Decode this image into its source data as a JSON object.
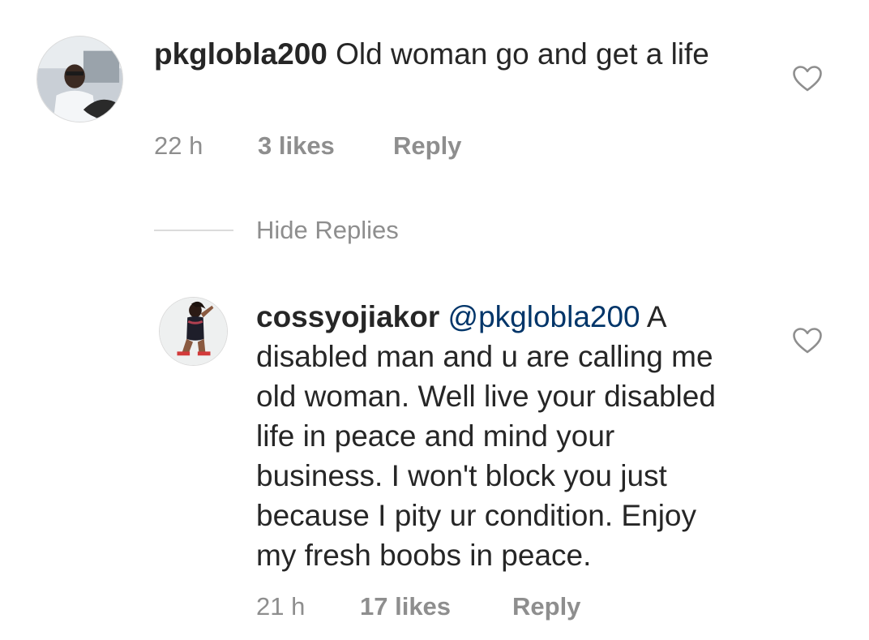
{
  "comments": [
    {
      "username": "pkglobla200",
      "text": "Old woman go and get a life",
      "time": "22 h",
      "likes": "3 likes",
      "reply_label": "Reply",
      "like_icon": "heart-outline-icon"
    }
  ],
  "thread": {
    "toggle_label": "Hide Replies"
  },
  "replies": [
    {
      "username": "cossyojiakor",
      "mention": "@pkglobla200",
      "text": "A disabled man and u are calling me old woman.  Well  live your disabled life in peace and mind your business. I won't block you just because I pity ur condition. Enjoy my fresh boobs in peace.",
      "time": "21 h",
      "likes": "17 likes",
      "reply_label": "Reply",
      "like_icon": "heart-outline-icon"
    }
  ],
  "colors": {
    "text": "#262626",
    "secondary": "#8e8e8e",
    "mention": "#003569",
    "divider": "#dbdbdb"
  }
}
